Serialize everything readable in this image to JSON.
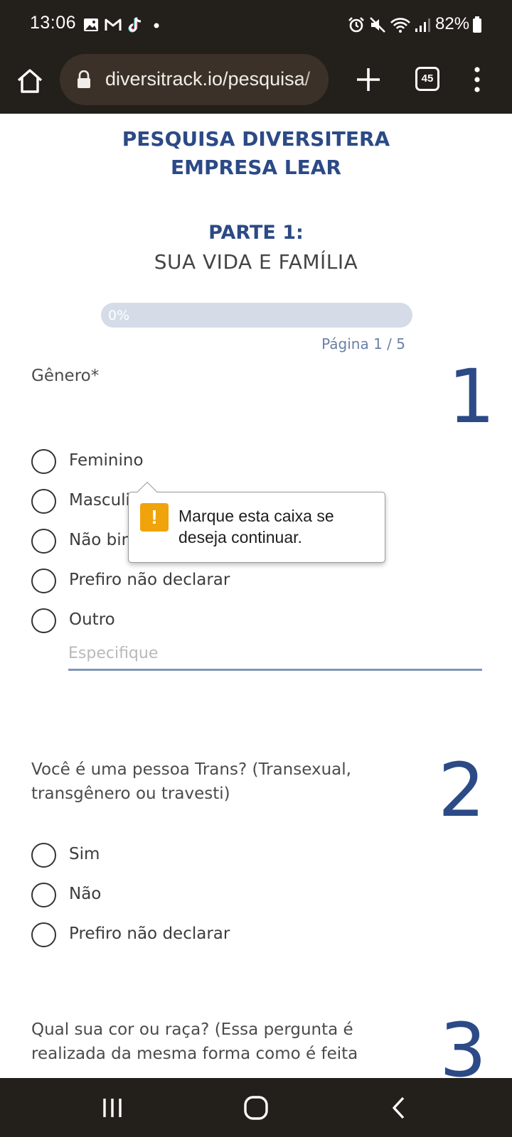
{
  "status_bar": {
    "time": "13:06",
    "battery": "82%",
    "icons": [
      "gallery-icon",
      "gmail-icon",
      "tiktok-icon",
      "notification-dot-icon",
      "alarm-icon",
      "mute-icon",
      "wifi-icon",
      "signal-icon",
      "battery-icon"
    ]
  },
  "browser": {
    "url": "diversitrack.io/pesquisa/",
    "tab_count": "45"
  },
  "survey": {
    "title_line1": "PESQUISA DIVERSITERA",
    "title_line2": "EMPRESA LEAR",
    "part_title": "PARTE 1:",
    "part_subtitle": "SUA VIDA E FAMÍLIA",
    "progress_label": "0%",
    "progress_value": 0,
    "page_indicator": "Página 1 / 5"
  },
  "questions": [
    {
      "number": "1",
      "text": "Gênero*",
      "options": [
        "Feminino",
        "Masculino",
        "Não binário",
        "Prefiro não declarar",
        "Outro"
      ],
      "specify_placeholder": "Especifique"
    },
    {
      "number": "2",
      "text_line1": "Você é uma pessoa Trans? (Transexual,",
      "text_line2": "transgênero ou travesti)",
      "options": [
        "Sim",
        "Não",
        "Prefiro não declarar"
      ]
    },
    {
      "number": "3",
      "text_line1": "Qual sua cor ou raça? (Essa pergunta é",
      "text_line2": "realizada da mesma forma como é feita"
    }
  ],
  "tooltip": {
    "icon": "!",
    "message": "Marque esta caixa se deseja continuar."
  },
  "colors": {
    "brand": "#2b4a86",
    "chrome": "#231f1b",
    "warning": "#f0a30a"
  }
}
